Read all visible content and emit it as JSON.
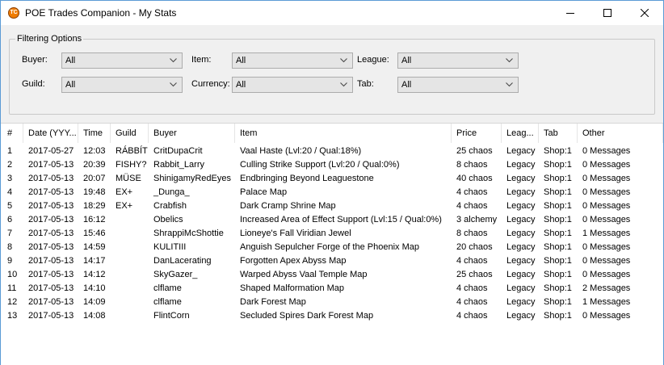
{
  "window": {
    "title": "POE Trades Companion - My Stats",
    "app_icon_text": "TC"
  },
  "filters": {
    "group_title": "Filtering Options",
    "buyer": {
      "label": "Buyer:",
      "value": "All"
    },
    "item": {
      "label": "Item:",
      "value": "All"
    },
    "league": {
      "label": "League:",
      "value": "All"
    },
    "guild": {
      "label": "Guild:",
      "value": "All"
    },
    "currency": {
      "label": "Currency:",
      "value": "All"
    },
    "tab": {
      "label": "Tab:",
      "value": "All"
    }
  },
  "table": {
    "columns": [
      "#",
      "Date (YYY...",
      "Time",
      "Guild",
      "Buyer",
      "Item",
      "Price",
      "Leag...",
      "Tab",
      "Other"
    ],
    "rows": [
      [
        "1",
        "2017-05-27",
        "12:03",
        "RÁBBÍT",
        "CritDupaCrit",
        "Vaal Haste (Lvl:20 / Qual:18%)",
        "25 chaos",
        "Legacy",
        "Shop:1",
        "0 Messages"
      ],
      [
        "2",
        "2017-05-13",
        "20:39",
        "FISHY?",
        "Rabbit_Larry",
        "Culling Strike Support (Lvl:20 / Qual:0%)",
        "8 chaos",
        "Legacy",
        "Shop:1",
        "0 Messages"
      ],
      [
        "3",
        "2017-05-13",
        "20:07",
        "MÜSE",
        "ShinigamyRedEyes",
        "Endbringing Beyond Leaguestone",
        "40 chaos",
        "Legacy",
        "Shop:1",
        "0 Messages"
      ],
      [
        "4",
        "2017-05-13",
        "19:48",
        "EX+",
        "_Dunga_",
        "Palace Map",
        "4 chaos",
        "Legacy",
        "Shop:1",
        "0 Messages"
      ],
      [
        "5",
        "2017-05-13",
        "18:29",
        "EX+",
        "Crabfish",
        "Dark Cramp Shrine Map",
        "4 chaos",
        "Legacy",
        "Shop:1",
        "0 Messages"
      ],
      [
        "6",
        "2017-05-13",
        "16:12",
        "",
        "Obelics",
        "Increased Area of Effect Support (Lvl:15 / Qual:0%)",
        "3 alchemy",
        "Legacy",
        "Shop:1",
        "0 Messages"
      ],
      [
        "7",
        "2017-05-13",
        "15:46",
        "",
        "ShrappiMcShottie",
        "Lioneye's Fall Viridian Jewel",
        "8 chaos",
        "Legacy",
        "Shop:1",
        "1 Messages"
      ],
      [
        "8",
        "2017-05-13",
        "14:59",
        "",
        "KULITIII",
        "Anguish Sepulcher Forge of the Phoenix Map",
        "20 chaos",
        "Legacy",
        "Shop:1",
        "0 Messages"
      ],
      [
        "9",
        "2017-05-13",
        "14:17",
        "",
        "DanLacerating",
        "Forgotten Apex Abyss Map",
        "4 chaos",
        "Legacy",
        "Shop:1",
        "0 Messages"
      ],
      [
        "10",
        "2017-05-13",
        "14:12",
        "",
        "SkyGazer_",
        "Warped Abyss Vaal Temple Map",
        "25 chaos",
        "Legacy",
        "Shop:1",
        "0 Messages"
      ],
      [
        "11",
        "2017-05-13",
        "14:10",
        "",
        "clflame",
        "Shaped Malformation Map",
        "4 chaos",
        "Legacy",
        "Shop:1",
        "2 Messages"
      ],
      [
        "12",
        "2017-05-13",
        "14:09",
        "",
        "clflame",
        "Dark Forest Map",
        "4 chaos",
        "Legacy",
        "Shop:1",
        "1 Messages"
      ],
      [
        "13",
        "2017-05-13",
        "14:08",
        "",
        "FlintCorn",
        "Secluded Spires Dark Forest Map",
        "4 chaos",
        "Legacy",
        "Shop:1",
        "0 Messages"
      ]
    ]
  }
}
